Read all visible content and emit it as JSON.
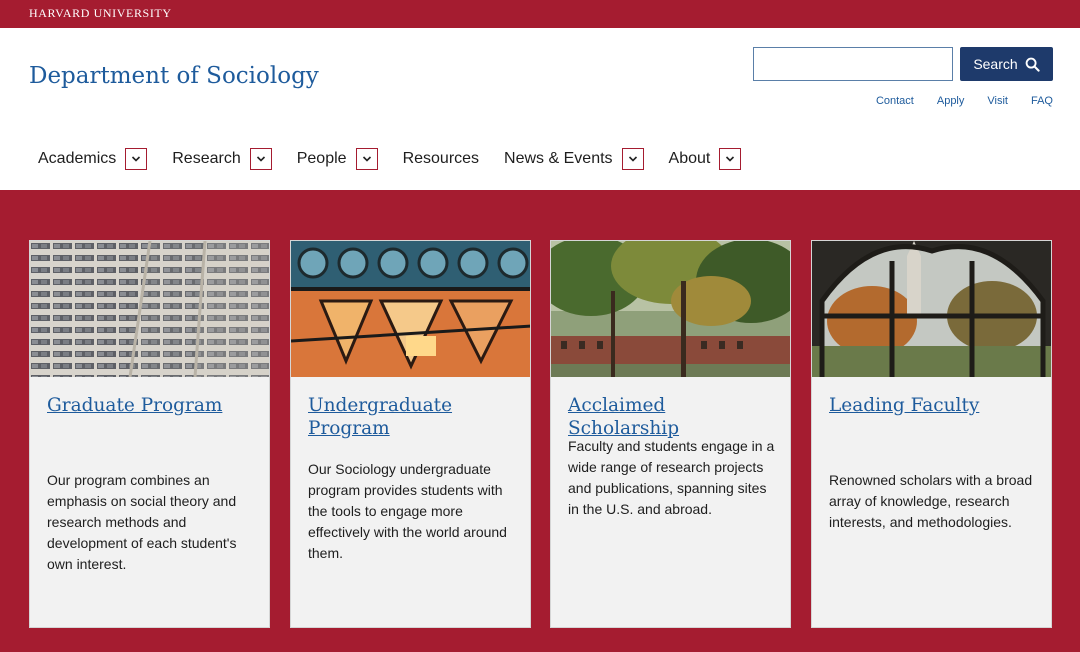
{
  "topbar": {
    "university": "HARVARD UNIVERSITY"
  },
  "header": {
    "title": "Department of Sociology",
    "search_placeholder": "",
    "search_label": "Search",
    "utility_links": [
      "Contact",
      "Apply",
      "Visit",
      "FAQ"
    ]
  },
  "nav": {
    "items": [
      {
        "label": "Academics",
        "has_dropdown": true
      },
      {
        "label": "Research",
        "has_dropdown": true
      },
      {
        "label": "People",
        "has_dropdown": true
      },
      {
        "label": "Resources",
        "has_dropdown": false
      },
      {
        "label": "News & Events",
        "has_dropdown": true
      },
      {
        "label": "About",
        "has_dropdown": true
      }
    ]
  },
  "cards": [
    {
      "title": "Graduate Program",
      "text": "Our program combines an emphasis on social theory and research methods and development of each student's own interest."
    },
    {
      "title": "Undergraduate Program",
      "text": "Our Sociology undergraduate program provides students with the tools to engage more effectively with the world around them."
    },
    {
      "title": "Acclaimed Scholarship",
      "text": "Faculty and students engage in a wide range of research projects and publications, spanning sites in the U.S. and abroad."
    },
    {
      "title": "Leading Faculty",
      "text": "Renowned scholars with a broad array of knowledge, research interests, and methodologies."
    }
  ],
  "colors": {
    "crimson": "#a51c30",
    "link_blue": "#1e5b9c",
    "button_navy": "#1e3a6b",
    "card_bg": "#f2f2f2"
  },
  "icons": {
    "search": "search-icon",
    "dropdown": "chevron-down-icon"
  }
}
